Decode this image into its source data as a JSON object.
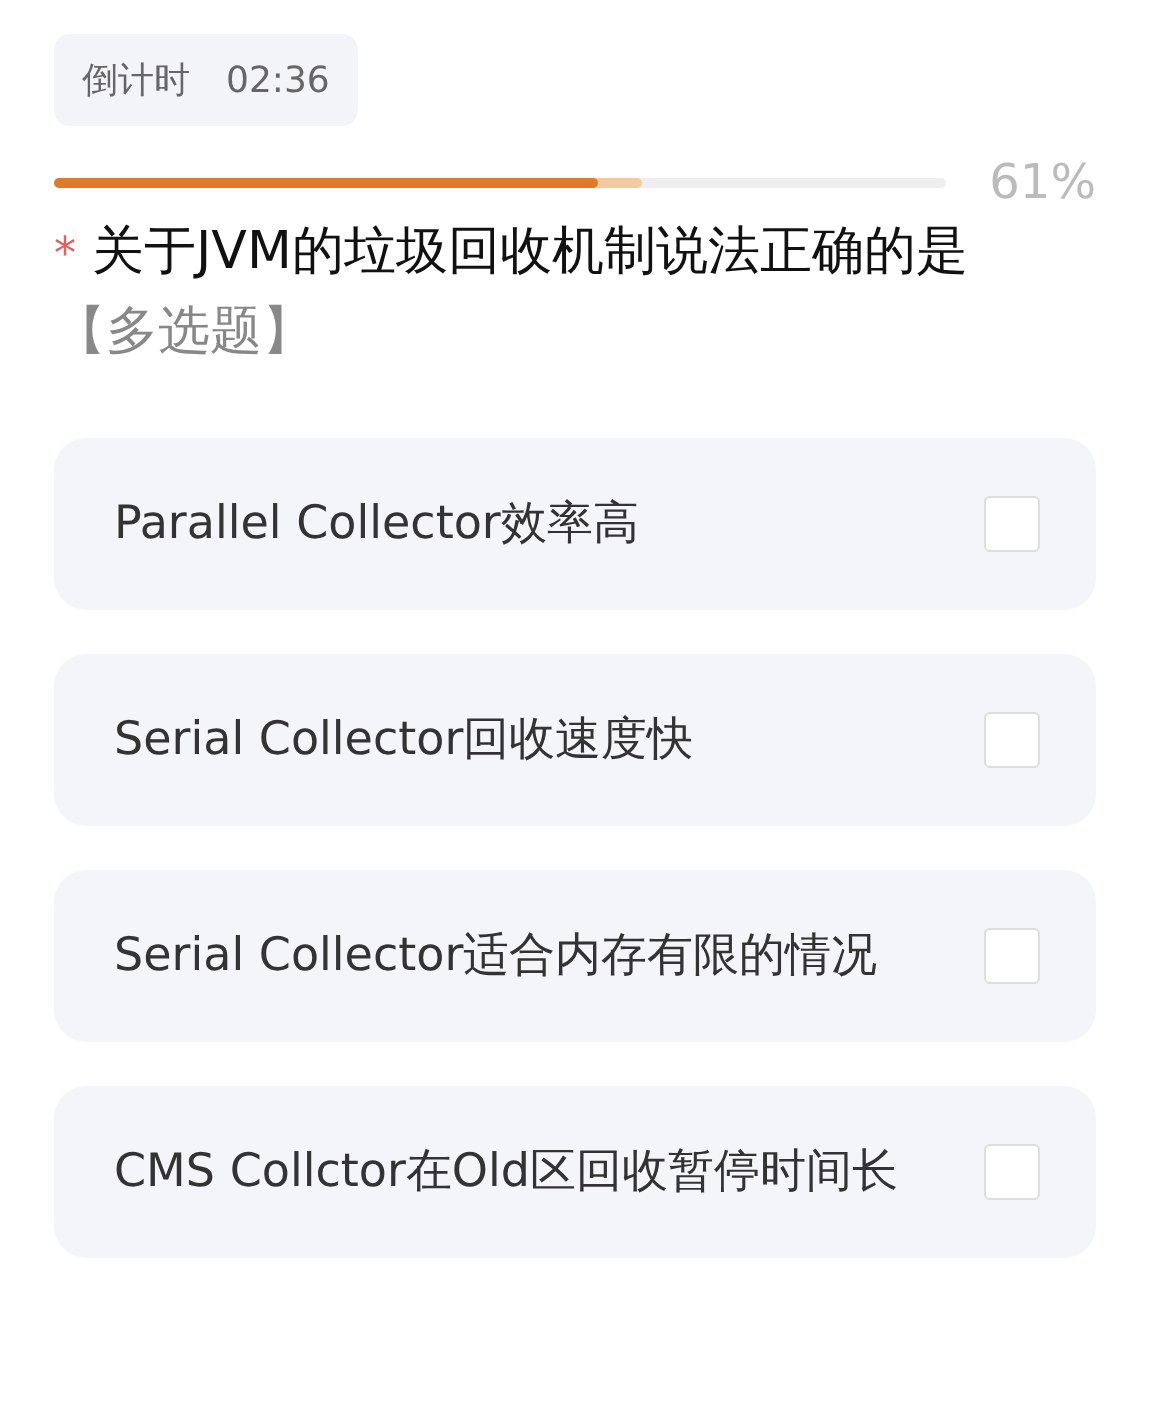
{
  "timer": {
    "label": "倒计时",
    "time": "02:36"
  },
  "progress": {
    "level": 0.61,
    "reading": "61%"
  },
  "question": {
    "required_mark": "*",
    "text": "关于JVM的垃圾回收机制说法正确的是",
    "type_tag": "【多选题】"
  },
  "options": [
    {
      "label": "Parallel Collector效率高",
      "checked": false
    },
    {
      "label": "Serial Collector回收速度快",
      "checked": false
    },
    {
      "label": "Serial Collector适合内存有限的情况",
      "checked": false
    },
    {
      "label": "CMS Collctor在Old区回收暂停时间长",
      "checked": false
    }
  ]
}
